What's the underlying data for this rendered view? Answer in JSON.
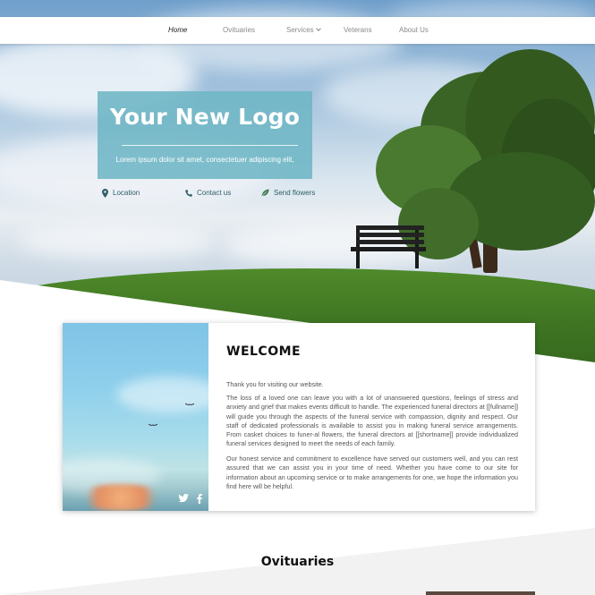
{
  "nav": {
    "items": [
      {
        "label": "Home",
        "active": true
      },
      {
        "label": "Ovituaries",
        "active": false
      },
      {
        "label": "Services",
        "active": false,
        "has_dropdown": true
      },
      {
        "label": "Veterans",
        "active": false
      },
      {
        "label": "About Us",
        "active": false
      }
    ]
  },
  "hero": {
    "logo_text": "Your New Logo",
    "tagline": "Lorem ipsum dolor sit amet, consectetuer adipiscing elit,",
    "links": {
      "location": "Location",
      "contact": "Contact us",
      "flowers": "Send flowers"
    }
  },
  "welcome": {
    "title": "WELCOME",
    "intro": "Thank you for visiting our website.",
    "paragraph1": "The loss of a loved one can leave you with a lot of unanswered questions, feelings of stress and anxiety and grief that makes events difficult to handle. The experienced funeral directors at [[fullname]] will guide you through the aspects of the funeral service with compassion, dignity and respect. Our staff of dedicated professionals is available to assist you in making funeral service arrangements. From casket choices to funer-al flowers, the funeral directors at [[shortname]] provide individualized funeral services designed to meet the needs of each family.",
    "paragraph2": "Our honest service and commitment to excellence have served our customers well, and you can rest assured that we can assist you in your time of need. Whether you have come to our site for information about an upcoming service or to make arrangements for one, we hope the information you find here will be helpful.",
    "social": {
      "twitter": "twitter-icon",
      "facebook": "facebook-icon"
    }
  },
  "obituaries": {
    "title": "Ovituaries"
  },
  "colors": {
    "accent": "#6eb6c5",
    "link": "#2f5e66"
  }
}
